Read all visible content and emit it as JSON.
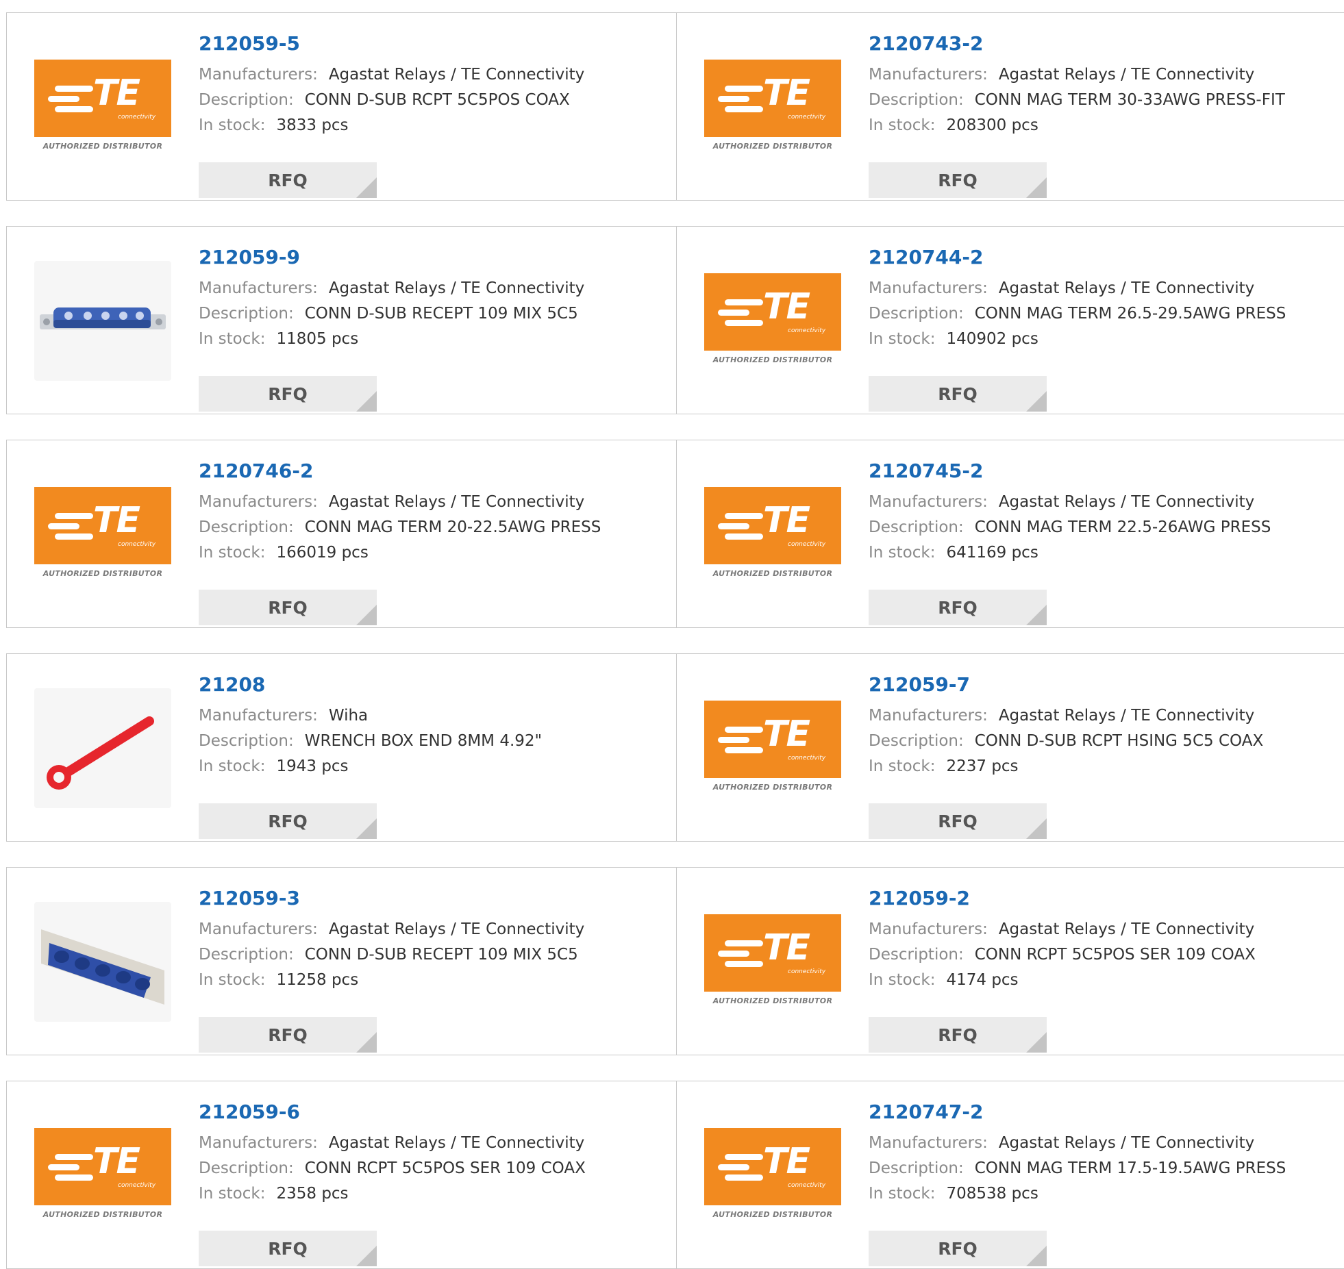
{
  "labels": {
    "manufacturers": "Manufacturers:",
    "description": "Description:",
    "in_stock": "In stock:",
    "rfq": "RFQ"
  },
  "te_logo": {
    "text": "TE",
    "sub": "connectivity",
    "authorized": "AUTHORIZED DISTRIBUTOR"
  },
  "colors": {
    "part_link": "#1a68b3",
    "te_orange": "#f28a1f",
    "rfq_bg": "#ebebeb"
  },
  "products": [
    {
      "part": "212059-5",
      "manufacturer": "Agastat Relays / TE Connectivity",
      "description": "CONN D-SUB RCPT 5C5POS COAX",
      "stock": "3833 pcs",
      "image": "te-logo"
    },
    {
      "part": "2120743-2",
      "manufacturer": "Agastat Relays / TE Connectivity",
      "description": "CONN MAG TERM 30-33AWG PRESS-FIT",
      "stock": "208300 pcs",
      "image": "te-logo"
    },
    {
      "part": "212059-9",
      "manufacturer": "Agastat Relays / TE Connectivity",
      "description": "CONN D-SUB RECEPT 109 MIX 5C5",
      "stock": "11805 pcs",
      "image": "dsub-small"
    },
    {
      "part": "2120744-2",
      "manufacturer": "Agastat Relays / TE Connectivity",
      "description": "CONN MAG TERM 26.5-29.5AWG PRESS",
      "stock": "140902 pcs",
      "image": "te-logo"
    },
    {
      "part": "2120746-2",
      "manufacturer": "Agastat Relays / TE Connectivity",
      "description": "CONN MAG TERM 20-22.5AWG PRESS",
      "stock": "166019 pcs",
      "image": "te-logo"
    },
    {
      "part": "2120745-2",
      "manufacturer": "Agastat Relays / TE Connectivity",
      "description": "CONN MAG TERM 22.5-26AWG PRESS",
      "stock": "641169 pcs",
      "image": "te-logo"
    },
    {
      "part": "21208",
      "manufacturer": "Wiha",
      "description": "WRENCH BOX END 8MM 4.92\"",
      "stock": "1943 pcs",
      "image": "wrench"
    },
    {
      "part": "212059-7",
      "manufacturer": "Agastat Relays / TE Connectivity",
      "description": "CONN D-SUB RCPT HSING 5C5 COAX",
      "stock": "2237 pcs",
      "image": "te-logo"
    },
    {
      "part": "212059-3",
      "manufacturer": "Agastat Relays / TE Connectivity",
      "description": "CONN D-SUB RECEPT 109 MIX 5C5",
      "stock": "11258 pcs",
      "image": "dsub-large"
    },
    {
      "part": "212059-2",
      "manufacturer": "Agastat Relays / TE Connectivity",
      "description": "CONN RCPT 5C5POS SER 109 COAX",
      "stock": "4174 pcs",
      "image": "te-logo"
    },
    {
      "part": "212059-6",
      "manufacturer": "Agastat Relays / TE Connectivity",
      "description": "CONN RCPT 5C5POS SER 109 COAX",
      "stock": "2358 pcs",
      "image": "te-logo"
    },
    {
      "part": "2120747-2",
      "manufacturer": "Agastat Relays / TE Connectivity",
      "description": "CONN MAG TERM 17.5-19.5AWG PRESS",
      "stock": "708538 pcs",
      "image": "te-logo"
    }
  ]
}
